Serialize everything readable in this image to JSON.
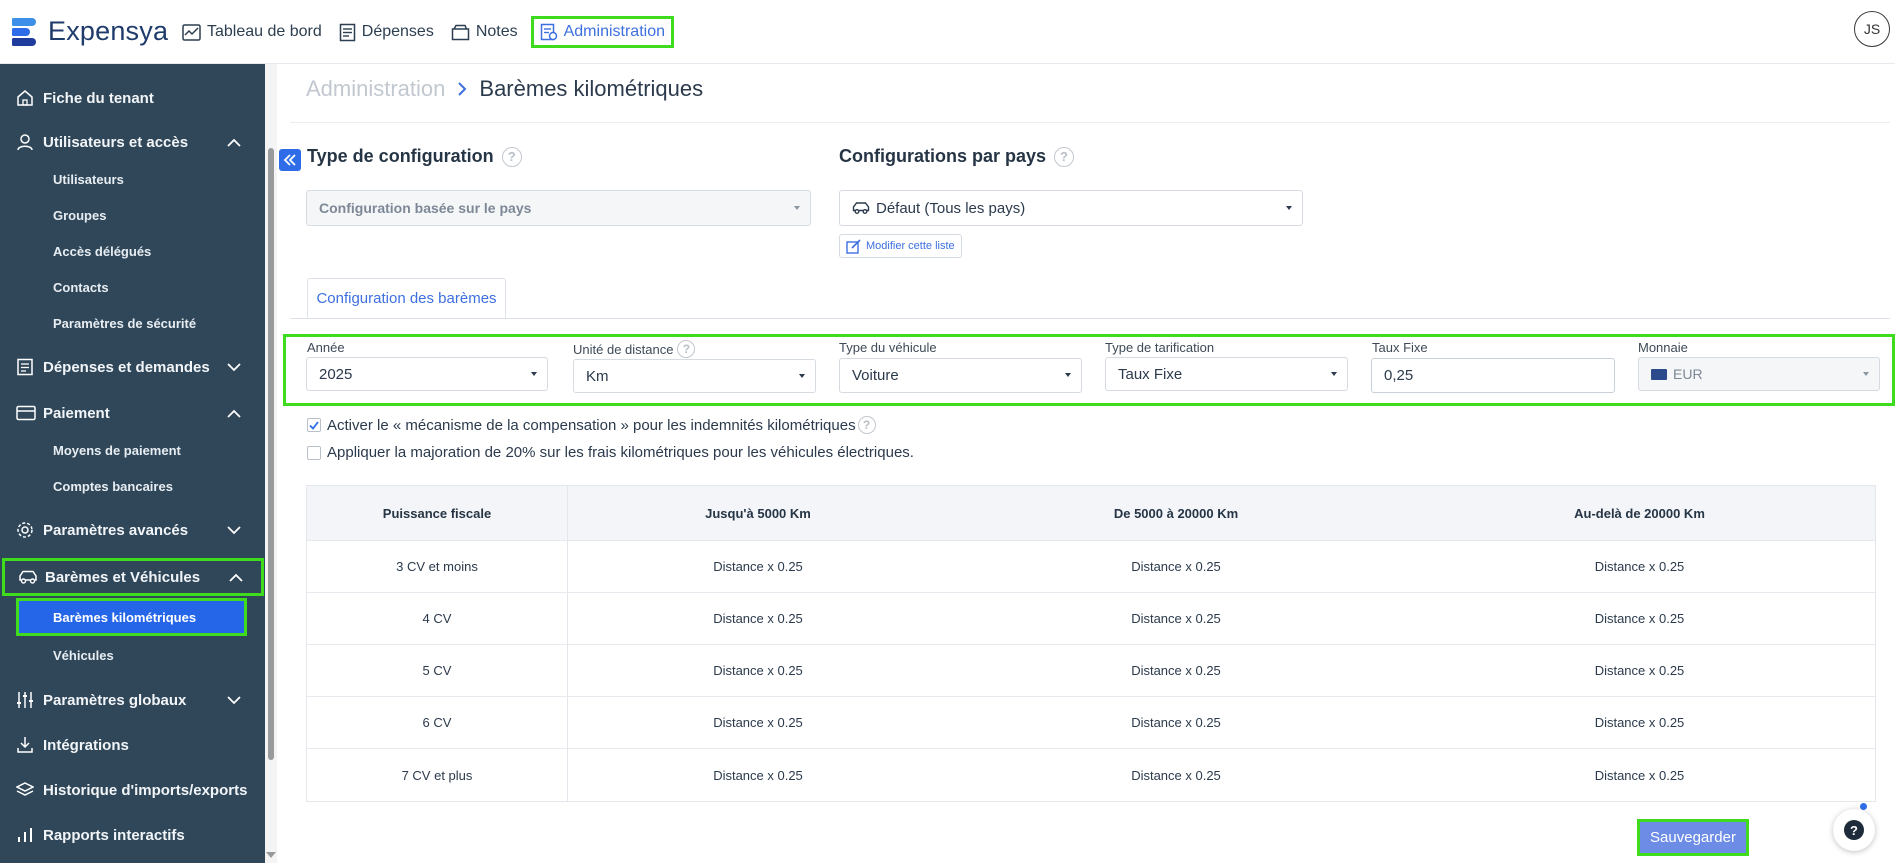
{
  "app": {
    "name": "Expensya",
    "user_initials": "JS"
  },
  "colors": {
    "accent": "#3d6fe0",
    "sidebar_bg": "#2f4759",
    "highlight": "#3fdc1e",
    "save_bg": "#6c8ce6"
  },
  "topnav": [
    {
      "label": "Tableau de bord",
      "icon": "dashboard-icon"
    },
    {
      "label": "Dépenses",
      "icon": "receipt-icon"
    },
    {
      "label": "Notes",
      "icon": "folder-icon"
    },
    {
      "label": "Administration",
      "icon": "admin-icon",
      "active": true
    }
  ],
  "sidebar": {
    "items": [
      {
        "label": "Fiche du tenant",
        "icon": "home-icon"
      },
      {
        "label": "Utilisateurs et accès",
        "icon": "user-icon",
        "expanded": true,
        "children": [
          "Utilisateurs",
          "Groupes",
          "Accès délégués",
          "Contacts",
          "Paramètres de sécurité"
        ]
      },
      {
        "label": "Dépenses et demandes",
        "icon": "receipt-icon",
        "expanded": false
      },
      {
        "label": "Paiement",
        "icon": "card-icon",
        "expanded": true,
        "children": [
          "Moyens de paiement",
          "Comptes bancaires"
        ]
      },
      {
        "label": "Paramètres avancés",
        "icon": "gear-icon",
        "expanded": false
      },
      {
        "label": "Barèmes et Véhicules",
        "icon": "car-icon",
        "expanded": true,
        "children": [
          "Barèmes kilométriques",
          "Véhicules"
        ]
      },
      {
        "label": "Paramètres globaux",
        "icon": "sliders-icon",
        "expanded": false
      },
      {
        "label": "Intégrations",
        "icon": "download-icon"
      },
      {
        "label": "Historique d'imports/exports",
        "icon": "layers-icon"
      },
      {
        "label": "Rapports interactifs",
        "icon": "bar-chart-icon"
      }
    ]
  },
  "breadcrumb": {
    "parent": "Administration",
    "current": "Barèmes kilométriques"
  },
  "config": {
    "type_title": "Type de configuration",
    "type_value": "Configuration basée sur le pays",
    "country_title": "Configurations par pays",
    "country_value": "Défaut (Tous les pays)",
    "modify_label": "Modifier cette liste"
  },
  "tab": {
    "label": "Configuration des barèmes"
  },
  "fields": {
    "annee": {
      "label": "Année",
      "value": "2025"
    },
    "unite": {
      "label": "Unité de distance",
      "value": "Km"
    },
    "vehicule": {
      "label": "Type du véhicule",
      "value": "Voiture"
    },
    "tarification": {
      "label": "Type de tarification",
      "value": "Taux Fixe"
    },
    "taux": {
      "label": "Taux Fixe",
      "value": "0,25"
    },
    "monnaie": {
      "label": "Monnaie",
      "value": "EUR"
    }
  },
  "checkboxes": [
    {
      "label": "Activer le « mécanisme de la compensation » pour les indemnités kilométriques",
      "checked": true
    },
    {
      "label": "Appliquer la majoration de 20% sur les frais kilométriques pour les véhicules électriques.",
      "checked": false
    }
  ],
  "table": {
    "headers": [
      "Puissance fiscale",
      "Jusqu'à 5000 Km",
      "De 5000 à 20000 Km",
      "Au-delà de 20000 Km"
    ],
    "rows": [
      [
        "3 CV et moins",
        "Distance x 0.25",
        "Distance x 0.25",
        "Distance x 0.25"
      ],
      [
        "4 CV",
        "Distance x 0.25",
        "Distance x 0.25",
        "Distance x 0.25"
      ],
      [
        "5 CV",
        "Distance x 0.25",
        "Distance x 0.25",
        "Distance x 0.25"
      ],
      [
        "6 CV",
        "Distance x 0.25",
        "Distance x 0.25",
        "Distance x 0.25"
      ],
      [
        "7 CV et plus",
        "Distance x 0.25",
        "Distance x 0.25",
        "Distance x 0.25"
      ]
    ]
  },
  "actions": {
    "save_label": "Sauvegarder",
    "help_label": "?"
  }
}
